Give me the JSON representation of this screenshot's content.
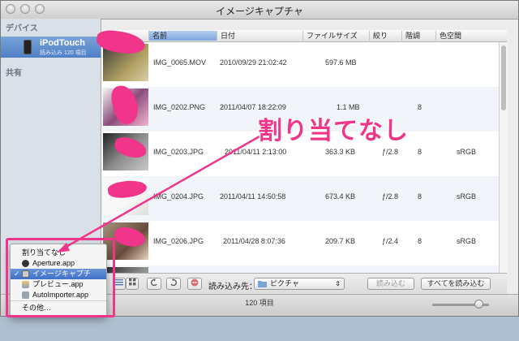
{
  "window": {
    "title": "イメージキャプチャ"
  },
  "sidebar": {
    "devices_heading": "デバイス",
    "device": {
      "name": "iPodTouch",
      "subtitle": "読み込み 120 項目"
    },
    "shared_heading": "共有"
  },
  "columns": [
    "名前",
    "日付",
    "ファイルサイズ",
    "絞り",
    "階調",
    "色空間"
  ],
  "rows": [
    {
      "name": "IMG_0065.MOV",
      "date": "2010/09/29 21:02:42",
      "size": "597.6 MB",
      "aperture": "",
      "depth": "",
      "colorspace": ""
    },
    {
      "name": "IMG_0202.PNG",
      "date": "2011/04/07 18:22:09",
      "size": "1.1 MB",
      "aperture": "",
      "depth": "8",
      "colorspace": ""
    },
    {
      "name": "IMG_0203.JPG",
      "date": "2011/04/11 2:13:00",
      "size": "363.3 KB",
      "aperture": "ƒ/2.8",
      "depth": "8",
      "colorspace": "sRGB"
    },
    {
      "name": "IMG_0204.JPG",
      "date": "2011/04/11 14:50:58",
      "size": "673.4 KB",
      "aperture": "ƒ/2.8",
      "depth": "8",
      "colorspace": "sRGB"
    },
    {
      "name": "IMG_0206.JPG",
      "date": "2011/04/28 8:07:36",
      "size": "209.7 KB",
      "aperture": "ƒ/2.4",
      "depth": "8",
      "colorspace": "sRGB"
    }
  ],
  "toolbar": {
    "import_to_label": "読み込み先：",
    "import_to_value": "ピクチャ",
    "import_button": "読み込む",
    "import_all_button": "すべてを読み込む"
  },
  "status": {
    "item_count": "120 項目"
  },
  "menu": {
    "items": [
      {
        "label": "割り当てなし",
        "checked": false
      },
      {
        "label": "Aperture.app",
        "checked": false
      },
      {
        "label": "イメージキャプチャ.app",
        "checked": true
      },
      {
        "label": "プレビュー.app",
        "checked": false
      },
      {
        "label": "AutoImporter.app",
        "checked": false
      },
      {
        "label": "その他…",
        "checked": false
      }
    ],
    "checkmark": "✓"
  },
  "annotation": {
    "text": "割り当てなし"
  },
  "colors": {
    "accent_pink": "#f0358a",
    "selection_blue": "#4f80c6"
  },
  "icons": [
    "ipod-icon",
    "list-view-icon",
    "grid-view-icon",
    "rotate-left-icon",
    "rotate-right-icon",
    "delete-icon",
    "folder-icon",
    "chevron-updown-icon",
    "checkmark-icon",
    "arrow-icon"
  ]
}
